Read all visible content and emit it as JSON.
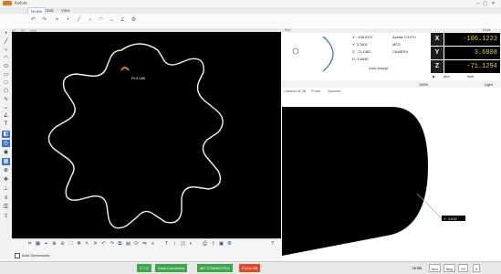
{
  "titlebar": {
    "title": "Kelvin",
    "min": "–",
    "max": "▢",
    "close": "✕"
  },
  "menu_tabs": [
    {
      "label": "Home"
    },
    {
      "label": "Edit"
    },
    {
      "label": "View"
    }
  ],
  "ribbon_icons": [
    "undo-icon",
    "redo-icon",
    "measure-icon",
    "point-icon",
    "line-icon",
    "circle-icon",
    "arc-icon",
    "distance-icon",
    "angle-icon",
    "settings-icon",
    "report-icon",
    "export-icon"
  ],
  "left_tools": [
    "point-icon",
    "line-icon",
    "circle-icon",
    "arc-icon",
    "ellipse-icon",
    "slot-icon",
    "rectangle-icon",
    "polygon-icon",
    "spline-icon",
    "distance-icon",
    "angle-icon",
    "text-icon",
    "edge-icon",
    "focus-icon",
    "camera-icon",
    "grid-icon",
    "zoom-icon",
    "pan-icon",
    "probe-icon",
    "align-icon",
    "report-icon",
    "export-icon",
    "move-icon",
    "delete-icon",
    "settings-icon",
    "wcs-icon"
  ],
  "cad_tabs": [
    "2D",
    "3D",
    "CAD"
  ],
  "cad": {
    "point_label": "Pt.0.186"
  },
  "cad_bottom_icons": [
    "snap-icon",
    "grid-icon",
    "measure-icon",
    "zoom-in-icon",
    "zoom-out-icon",
    "fit-icon",
    "pan-icon",
    "select-icon",
    "delete-icon",
    "undo-icon",
    "redo-icon",
    "copy-icon",
    "paste-icon",
    "rotate-icon",
    "mirror-icon",
    "align-icon",
    "text-icon",
    "dimension-icon",
    "layer-icon",
    "color-icon",
    "print-icon",
    "export-icon",
    "save-icon",
    "settings-icon",
    "help-icon"
  ],
  "cad_bottom_checkbox": "Auto Dimensions",
  "right_panel": {
    "header_left": "Run",
    "header_right": "Mode",
    "coords": {
      "x": "X: -106.0207",
      "y": "Y: 3.7801",
      "z": "Z: -71.1362",
      "d": "D: 3.6830",
      "angle": "Azelta: 0.1070",
      "mcs": "MCS",
      "camera": "CAMERA",
      "auto_accept": "Auto Accept"
    },
    "axes": [
      {
        "label": "X",
        "value": "-106.1223"
      },
      {
        "label": "Y",
        "value": "3.6808"
      },
      {
        "label": "Z",
        "value": "-71.1294"
      }
    ],
    "unit_mm": "mm",
    "unit_in": "inch"
  },
  "mid_bar": {
    "zoom": "100%",
    "light": "Light"
  },
  "camera_tabs": [
    "Camera 01.08",
    "Probe",
    "Scanner"
  ],
  "camera": {
    "measure_label": "Y: 4.034"
  },
  "status": {
    "xyz": "X Y Z",
    "connected": "Kalid Connected",
    "mc": "MC CONNECTED",
    "probe": "Probe Off",
    "units_label": "Units",
    "unit_value": "mm",
    "deg": "deg",
    "plane": "XY",
    "val": "0"
  },
  "colors": {
    "accent": "#e07a1f",
    "axis_value": "#f2d43a",
    "status_green": "#3aa84a",
    "status_red": "#e34a2a"
  }
}
